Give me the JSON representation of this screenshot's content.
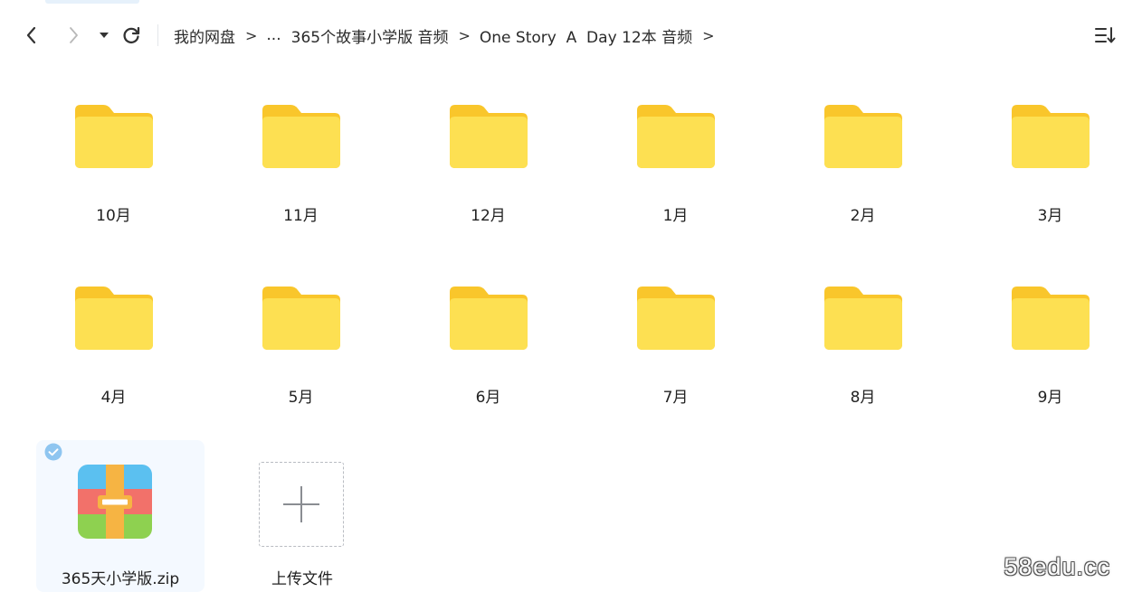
{
  "toolbar": {
    "back_icon": "chevron-left-icon",
    "forward_icon": "chevron-right-icon",
    "history_icon": "caret-down-icon",
    "refresh_icon": "refresh-icon",
    "sort_icon": "sort-icon"
  },
  "breadcrumb": {
    "items": [
      "我的网盘",
      "...",
      "365个故事小学版 音频",
      "One Story  A  Day 12本 音频"
    ],
    "separator": ">"
  },
  "folders": [
    {
      "name": "10月"
    },
    {
      "name": "11月"
    },
    {
      "name": "12月"
    },
    {
      "name": "1月"
    },
    {
      "name": "2月"
    },
    {
      "name": "3月"
    },
    {
      "name": "4月"
    },
    {
      "name": "5月"
    },
    {
      "name": "6月"
    },
    {
      "name": "7月"
    },
    {
      "name": "8月"
    },
    {
      "name": "9月"
    }
  ],
  "files": [
    {
      "name": "365天小学版.zip",
      "icon": "archive-icon",
      "selected": true
    }
  ],
  "upload": {
    "label": "上传文件",
    "icon": "plus-icon"
  },
  "watermark": "58edu.cc",
  "colors": {
    "folder_back": "#f9c62b",
    "folder_front": "#fde052",
    "selected_bg": "#f4f9ff",
    "check": "#8ec5f0"
  }
}
